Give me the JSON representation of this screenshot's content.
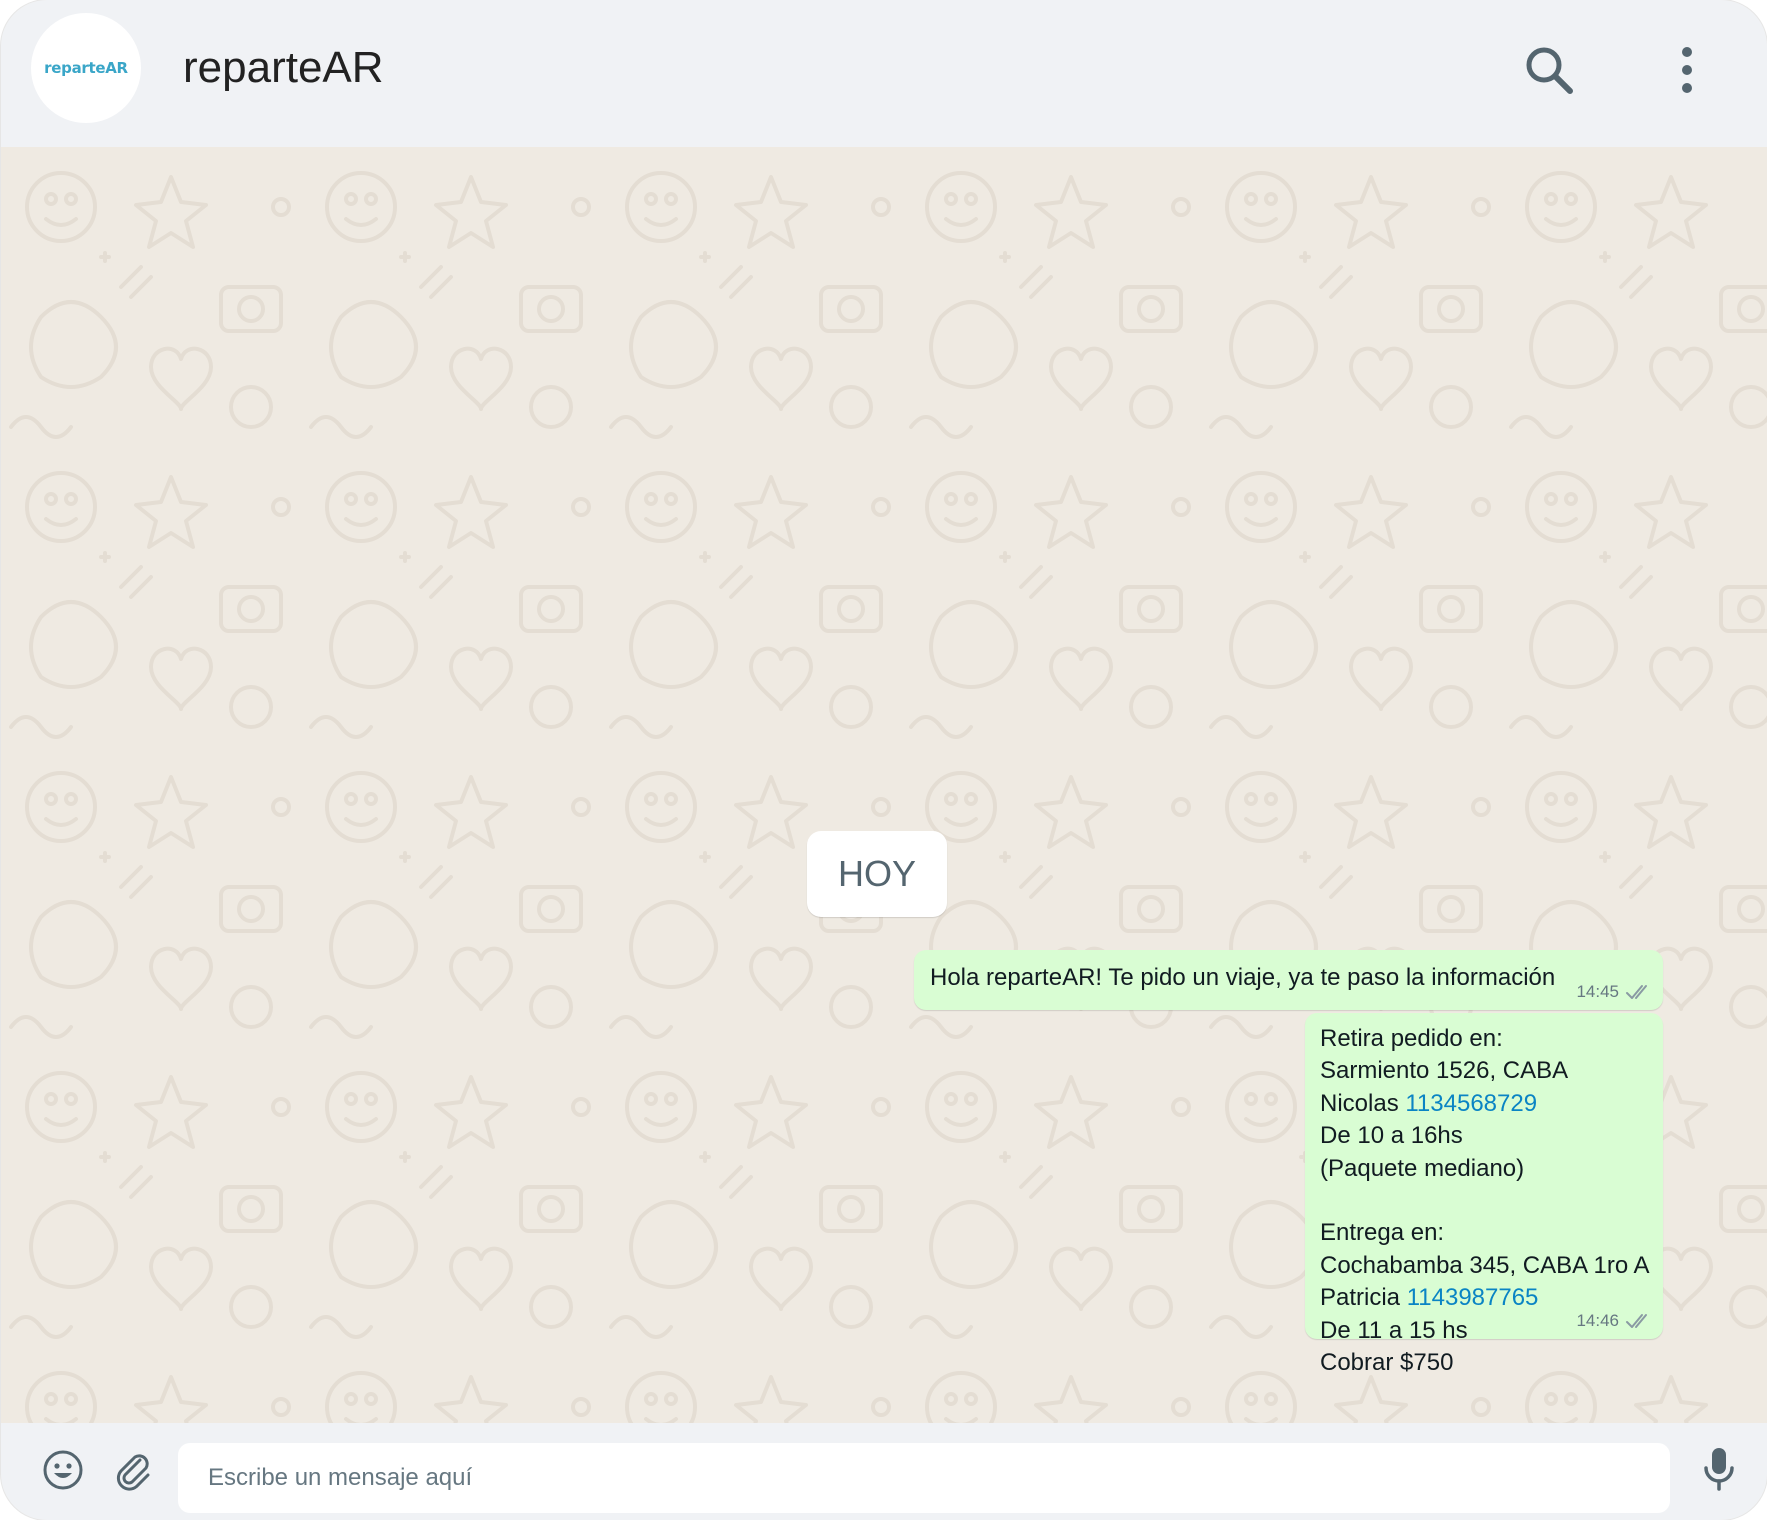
{
  "header": {
    "logo_text": "reparteAR",
    "title": "reparteAR",
    "search_icon": "search-icon",
    "menu_icon": "kebab-menu-icon"
  },
  "chat": {
    "day_chip": "HOY",
    "messages": [
      {
        "text": "Hola reparteAR! Te pido un viaje, ya te paso la información",
        "time": "14:45",
        "status_icon": "double-check-icon"
      },
      {
        "lines": {
          "l1": "Retira pedido en:",
          "l2": "Sarmiento 1526, CABA",
          "l3_name": "Nicolas ",
          "l3_phone": "1134568729",
          "l4": "De 10 a 16hs",
          "l5": "(Paquete mediano)",
          "l7": "Entrega en:",
          "l8": "Cochabamba 345, CABA 1ro A",
          "l9_name": "Patricia ",
          "l9_phone": "1143987765",
          "l10": "De 11 a 15 hs",
          "l11": "Cobrar $750"
        },
        "time": "14:46",
        "status_icon": "double-check-icon"
      }
    ]
  },
  "composer": {
    "placeholder": "Escribe un mensaje aquí",
    "value": "",
    "emoji_icon": "emoji-icon",
    "attach_icon": "paperclip-icon",
    "mic_icon": "microphone-icon"
  },
  "colors": {
    "header_bg": "#f0f2f5",
    "chat_bg": "#efeae2",
    "outgoing_bubble": "#d9fdd3",
    "link": "#0a84c4",
    "logo": "#3aa6c8"
  }
}
